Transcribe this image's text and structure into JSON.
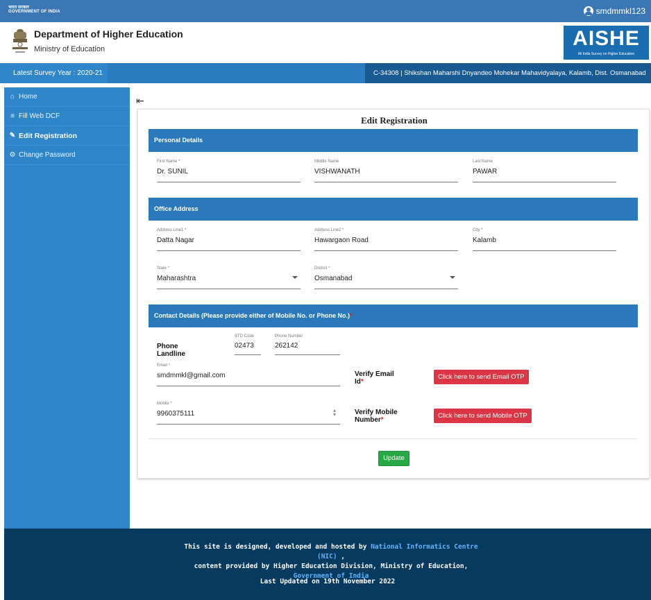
{
  "gov_bar": {
    "hindi": "भारत सरकार",
    "english": "GOVERNMENT OF INDIA",
    "username": "smdmmkl123",
    "user_icon": "user-circle-icon"
  },
  "brand": {
    "dept_title": "Department of Higher Education",
    "ministry": "Ministry of Education",
    "logo_text": "AISHE",
    "logo_subtitle": "All India Survey on Higher Education",
    "brand_color": "#1b6db1"
  },
  "survey_bar": {
    "year": "Latest Survey Year : 2020-21",
    "institute": "C-34308 | Shikshan Maharshi Dnyandeo Mohekar Mahavidyalaya, Kalamb, Dist. Osmanabad"
  },
  "sidebar": {
    "items": [
      {
        "label": "Home",
        "icon": "home-icon"
      },
      {
        "label": "Fill Web DCF",
        "icon": "list-icon"
      },
      {
        "label": "Edit Registration",
        "icon": "edit-icon"
      },
      {
        "label": "Change Password",
        "icon": "gear-icon"
      }
    ]
  },
  "form": {
    "title": "Edit Registration",
    "personal": {
      "heading": "Personal Details",
      "first_name_label": "First Name *",
      "first_name": "Dr. SUNIL",
      "middle_name_label": "Middle Name",
      "middle_name": "VISHWANATH",
      "last_name_label": "Last Name",
      "last_name": "PAWAR"
    },
    "office": {
      "heading": "Office Address",
      "address1_label": "Address Line1 *",
      "address1": "Datta Nagar",
      "address2_label": "Address Line2 *",
      "address2": "Hawargaon Road",
      "city_label": "City *",
      "city": "Kalamb",
      "state_label": "State *",
      "state": "Maharashtra",
      "district_label": "District *",
      "district": "Osmanabad"
    },
    "contact": {
      "heading": "Contact Details (Please provide either of Mobile No. or Phone No.)",
      "heading_required": "*",
      "phone_landline_label_1": "Phone",
      "phone_landline_label_2": "Landline",
      "std_label": "STD Code",
      "std_value": "02473",
      "phone_label": "Phone Number",
      "phone_value": "262142",
      "email_label": "Email *",
      "email_value": "smdmmkl@gmail.com",
      "verify_email_1": "Verify Email",
      "verify_email_2": "Id",
      "email_otp_button": "Click here to send Email OTP",
      "mobile_label": "Mobile *",
      "mobile_value": "9960375111",
      "verify_mobile_1": "Verify Mobile",
      "verify_mobile_2": "Number",
      "mobile_otp_button": "Click here to send Mobile OTP",
      "required_mark": "*"
    },
    "update_button": "Update"
  },
  "footer": {
    "line1_pre": "This site is designed, developed and hosted by ",
    "nic_link": "National Informatics Centre (NIC)",
    "line1_post": " ,",
    "line2_pre": "content provided by Higher Education Division, Ministry of Education, ",
    "goi_link": "Government of India",
    "updated": "Last Updated on 19th November 2022"
  },
  "colors": {
    "primary_blue": "#2b79ba",
    "sidebar_blue": "#2e86c9",
    "footer_navy": "#063b5f",
    "danger_red": "#dc3545",
    "success_green": "#28a745"
  }
}
